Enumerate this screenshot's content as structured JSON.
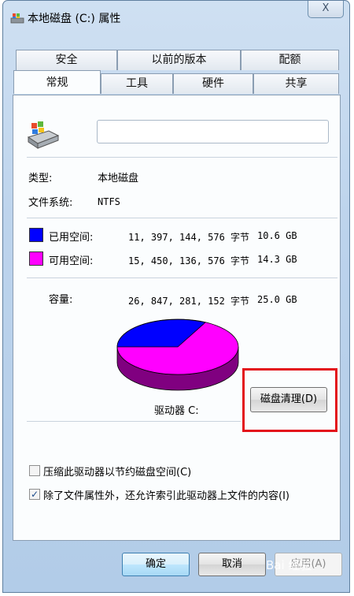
{
  "window": {
    "title": "本地磁盘 (C:) 属性",
    "close_glyph": "X"
  },
  "tabs": {
    "row1": [
      "安全",
      "以前的版本",
      "配额"
    ],
    "row2": [
      "常规",
      "工具",
      "硬件",
      "共享"
    ],
    "active": "常规"
  },
  "general": {
    "name_field_value": "",
    "type_label": "类型:",
    "type_value": "本地磁盘",
    "fs_label": "文件系统:",
    "fs_value": "NTFS",
    "used": {
      "label": "已用空间:",
      "bytes": "11, 397, 144, 576 字节",
      "size": "10.6 GB",
      "color": "#0000ff"
    },
    "free": {
      "label": "可用空间:",
      "bytes": "15, 450, 136, 576 字节",
      "size": "14.3 GB",
      "color": "#ff00ff"
    },
    "capacity": {
      "label": "容量:",
      "bytes": "26, 847, 281, 152 字节",
      "size": "25.0 GB"
    },
    "drive_label": "驱动器 C:",
    "cleanup_button": "磁盘清理(D)",
    "compress_checkbox": {
      "label": "压缩此驱动器以节约磁盘空间(C)",
      "checked": false
    },
    "index_checkbox": {
      "label": "除了文件属性外，还允许索引此驱动器上文件的内容(I)",
      "checked": true
    },
    "check_mark": "✓"
  },
  "buttons": {
    "ok": "确定",
    "cancel": "取消",
    "apply": "应用(A)"
  },
  "watermark": "Bai 经验",
  "colors": {
    "used": "#0000ff",
    "free": "#ff00ff",
    "highlight": "#e3131b"
  }
}
